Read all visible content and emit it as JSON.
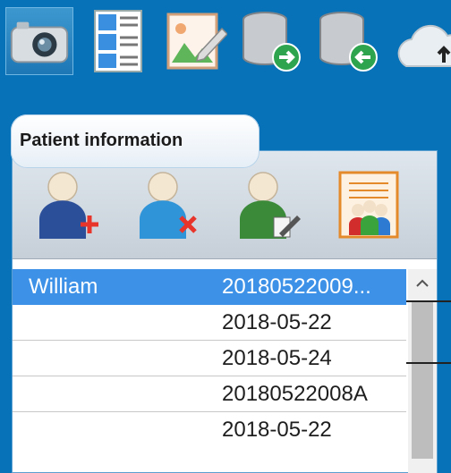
{
  "toolbar": {
    "buttons": [
      {
        "icon": "camera-icon"
      },
      {
        "icon": "list-layout-icon"
      },
      {
        "icon": "image-edit-icon"
      },
      {
        "icon": "database-export-icon"
      },
      {
        "icon": "database-import-icon"
      },
      {
        "icon": "cloud-upload-icon"
      }
    ]
  },
  "tab": {
    "label": "Patient information"
  },
  "panel": {
    "buttons": [
      {
        "icon": "add-patient-icon"
      },
      {
        "icon": "delete-patient-icon"
      },
      {
        "icon": "edit-patient-icon"
      },
      {
        "icon": "patient-report-icon"
      }
    ],
    "rows": [
      {
        "name": "William",
        "value": "20180522009..."
      },
      {
        "name": "",
        "value": "2018-05-22"
      },
      {
        "name": "",
        "value": "2018-05-24"
      },
      {
        "name": "",
        "value": "20180522008A"
      },
      {
        "name": "",
        "value": "2018-05-22"
      }
    ]
  },
  "colors": {
    "background": "#0872b8",
    "selected_row": "#3d92e8"
  }
}
